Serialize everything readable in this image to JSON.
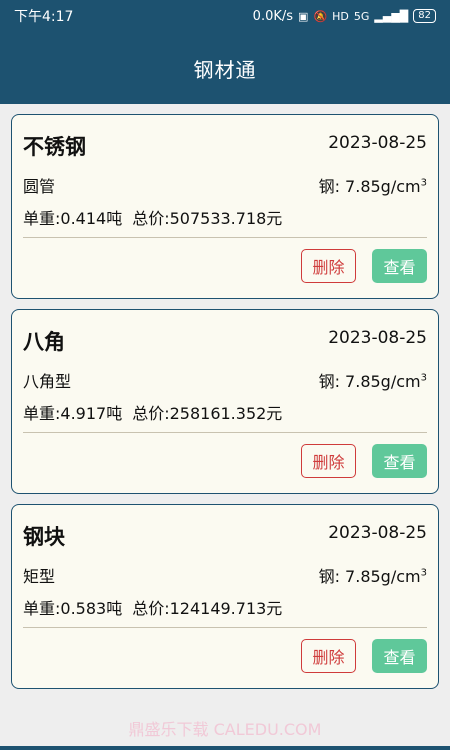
{
  "status_bar": {
    "time": "下午4:17",
    "network_speed": "0.0K/s",
    "icons": [
      "nfc-icon",
      "mute-icon",
      "hd-icon",
      "5g-icon",
      "signal-icon"
    ],
    "hd_label": "HD",
    "net_label": "5G",
    "battery": "82"
  },
  "app_bar": {
    "title": "钢材通"
  },
  "density_label": "钢: 7.85g/cm",
  "density_sup": "3",
  "buttons": {
    "delete": "删除",
    "view": "查看"
  },
  "items": [
    {
      "name": "不锈钢",
      "date": "2023-08-25",
      "type": "圆管",
      "unit_weight": "单重:0.414吨",
      "total_price": "总价:507533.718元"
    },
    {
      "name": "八角",
      "date": "2023-08-25",
      "type": "八角型",
      "unit_weight": "单重:4.917吨",
      "total_price": "总价:258161.352元"
    },
    {
      "name": "钢块",
      "date": "2023-08-25",
      "type": "矩型",
      "unit_weight": "单重:0.583吨",
      "total_price": "总价:124149.713元"
    }
  ],
  "watermark": "鼎盛乐下载 CALEDU.COM",
  "colors": {
    "primary": "#1d5270",
    "card_bg": "#fbfaf1",
    "delete": "#cf3b3b",
    "view": "#5fc89a"
  }
}
